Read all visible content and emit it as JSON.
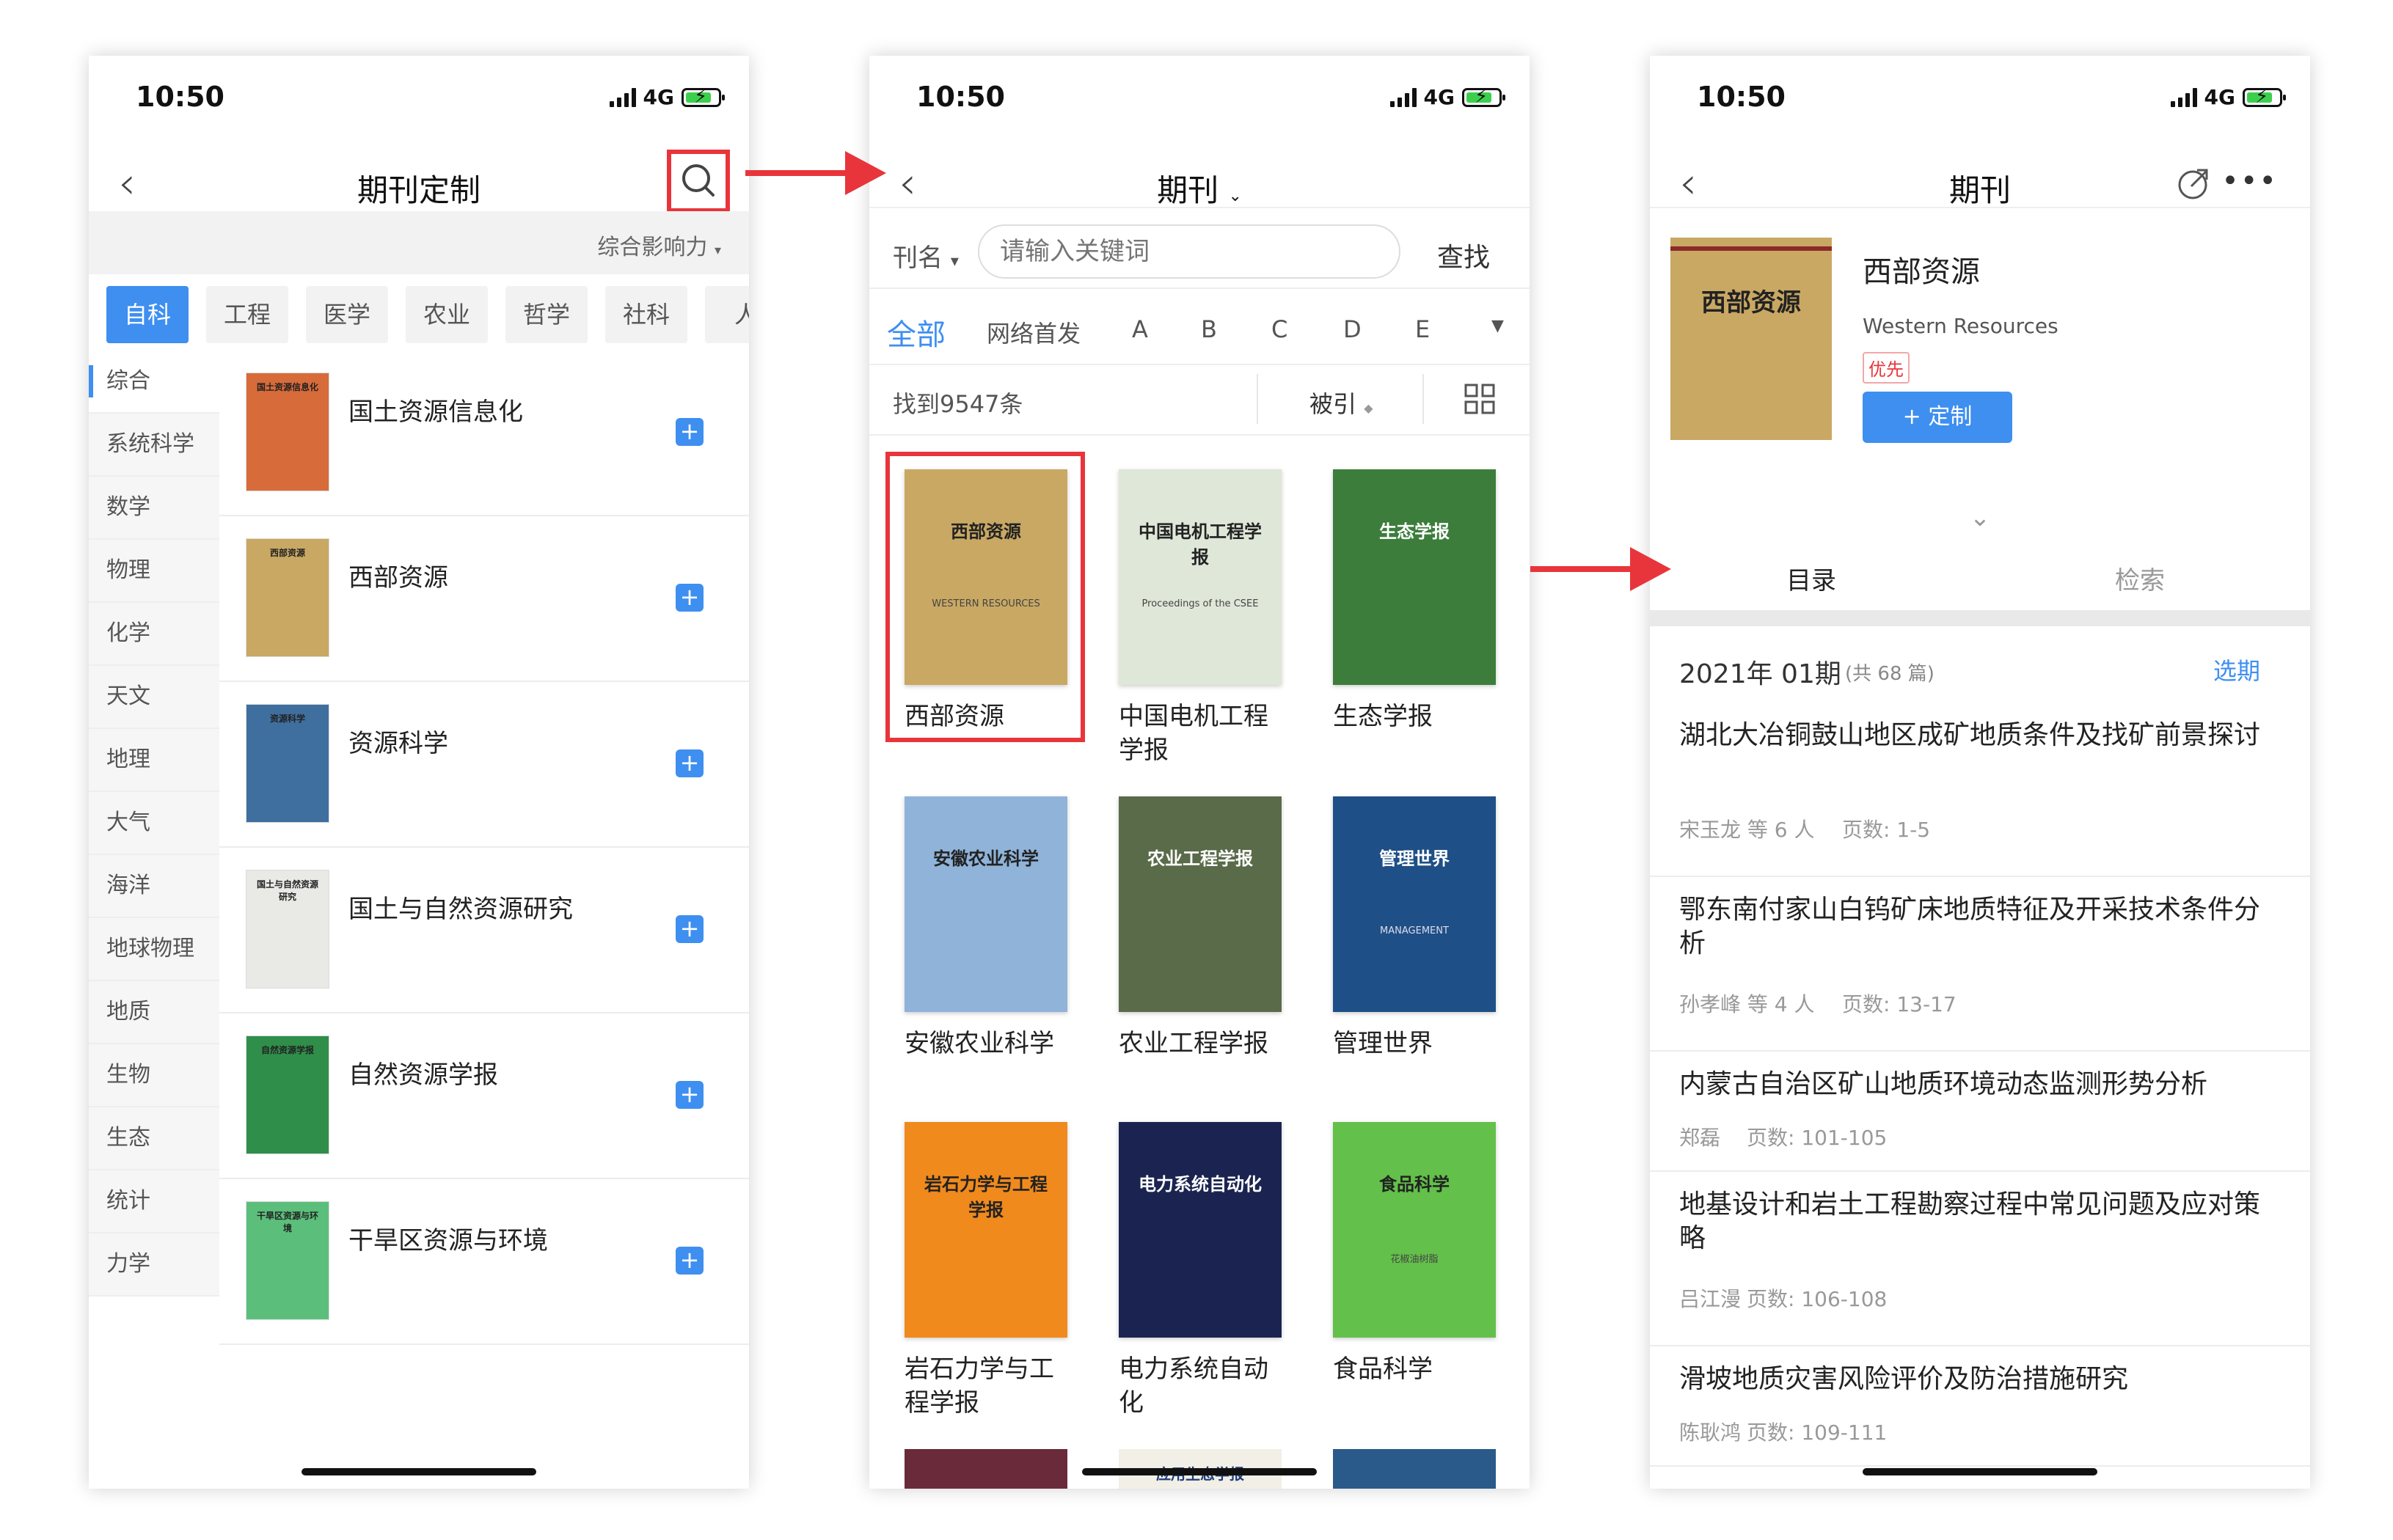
{
  "status": {
    "time": "10:50",
    "network": "4G"
  },
  "screen1": {
    "title": "期刊定制",
    "sort_label": "综合影响力",
    "categories": [
      "自科",
      "工程",
      "医学",
      "农业",
      "哲学",
      "社科",
      "人"
    ],
    "sidebar": [
      "综合",
      "系统科学",
      "数学",
      "物理",
      "化学",
      "天文",
      "地理",
      "大气",
      "海洋",
      "地球物理",
      "地质",
      "生物",
      "生态",
      "统计",
      "力学"
    ],
    "journals": [
      {
        "name": "国土资源信息化",
        "cover_text": "国土资源信息化",
        "color": "#d86b3a"
      },
      {
        "name": "西部资源",
        "cover_text": "西部资源",
        "color": "#c9a863"
      },
      {
        "name": "资源科学",
        "cover_text": "资源科学",
        "color": "#3f6f9e"
      },
      {
        "name": "国土与自然资源研究",
        "cover_text": "国土与自然资源研究",
        "color": "#e9e9e6"
      },
      {
        "name": "自然资源学报",
        "cover_text": "自然资源学报",
        "color": "#2f8f4a"
      },
      {
        "name": "干旱区资源与环境",
        "cover_text": "干旱区资源与环境",
        "color": "#5bbf7b"
      }
    ]
  },
  "screen2": {
    "title": "期刊",
    "field_label": "刊名",
    "search_placeholder": "请输入关键词",
    "search_button": "查找",
    "filters": [
      "全部",
      "网络首发",
      "A",
      "B",
      "C",
      "D",
      "E"
    ],
    "result_count": "找到9547条",
    "sort_label": "被引",
    "journals": [
      {
        "name": "西部资源",
        "cover_text": "西部资源",
        "cover_sub": "WESTERN RESOURCES",
        "color": "#c9a863"
      },
      {
        "name": "中国电机工程学报",
        "cover_text": "中国电机工程学报",
        "cover_sub": "Proceedings of the CSEE",
        "color": "#dfe7d8"
      },
      {
        "name": "生态学报",
        "cover_text": "生态学报",
        "cover_sub": "",
        "color": "#3c7d3c"
      },
      {
        "name": "安徽农业科学",
        "cover_text": "安徽农业科学",
        "cover_sub": "",
        "color": "#8fb3d9"
      },
      {
        "name": "农业工程学报",
        "cover_text": "农业工程学报",
        "cover_sub": "",
        "color": "#5a6b4a"
      },
      {
        "name": "管理世界",
        "cover_text": "管理世界",
        "cover_sub": "MANAGEMENT",
        "color": "#1e4f86"
      },
      {
        "name": "岩石力学与工程学报",
        "cover_text": "岩石力学与工程学报",
        "cover_sub": "",
        "color": "#f08a1c"
      },
      {
        "name": "电力系统自动化",
        "cover_text": "电力系统自动化",
        "cover_sub": "",
        "color": "#1b2450"
      },
      {
        "name": "食品科学",
        "cover_text": "食品科学",
        "cover_sub": "花椒油树脂",
        "color": "#63c04a"
      }
    ],
    "partial_cover_text": "应用生态学报"
  },
  "screen3": {
    "title": "期刊",
    "journal_name": "西部资源",
    "journal_en": "Western Resources",
    "badge": "优先",
    "subscribe_button": "+ 定制",
    "cover_text": "西部资源",
    "tabs": [
      "目录",
      "检索"
    ],
    "issue": "2021年 01期",
    "issue_count": "(共 68 篇)",
    "select_issue": "选期",
    "articles": [
      {
        "title": "湖北大冶铜鼓山地区成矿地质条件及找矿前景探讨",
        "authors": "宋玉龙 等 6 人",
        "pages": "页数: 1-5"
      },
      {
        "title": "鄂东南付家山白钨矿床地质特征及开采技术条件分析",
        "authors": "孙孝峰 等 4 人",
        "pages": "页数: 13-17"
      },
      {
        "title": "内蒙古自治区矿山地质环境动态监测形势分析",
        "authors": "郑磊",
        "pages": "页数: 101-105"
      },
      {
        "title": "地基设计和岩土工程勘察过程中常见问题及应对策略",
        "authors": "吕江漫",
        "pages": "页数: 106-108"
      },
      {
        "title": "滑坡地质灾害风险评价及防治措施研究",
        "authors": "陈耿鸿",
        "pages": "页数: 109-111"
      }
    ]
  },
  "colors": {
    "accent": "#3e8ff0",
    "highlight": "#e8353b",
    "badge": "#e8353b"
  }
}
